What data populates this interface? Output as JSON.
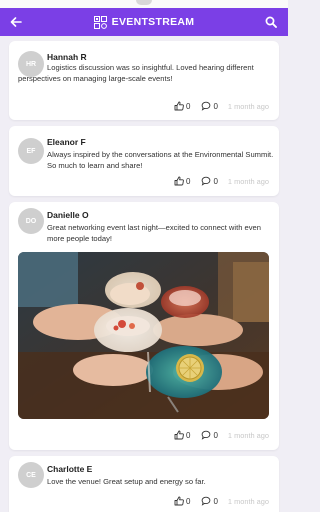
{
  "header": {
    "title": "EVENTSTREAM",
    "accent": "#7b3fe6"
  },
  "posts": [
    {
      "initials": "HR",
      "name": "Hannah R",
      "text": "Logistics discussion was so insightful. Loved hearing different perspectives on managing large-scale events!",
      "likes": "0",
      "comments": "0",
      "time": "1 month ago"
    },
    {
      "initials": "EF",
      "name": "Eleanor F",
      "text": "Always inspired by the conversations at the Environmental Summit. So much to learn and share!",
      "likes": "0",
      "comments": "0",
      "time": "1 month ago"
    },
    {
      "initials": "DO",
      "name": "Danielle O",
      "text": "Great networking event last night—excited to connect with even more people today!",
      "likes": "0",
      "comments": "0",
      "time": "1 month ago"
    },
    {
      "initials": "CE",
      "name": "Charlotte E",
      "text": "Love the venue! Great setup and energy so far.",
      "likes": "0",
      "comments": "0",
      "time": "1 month ago"
    }
  ]
}
